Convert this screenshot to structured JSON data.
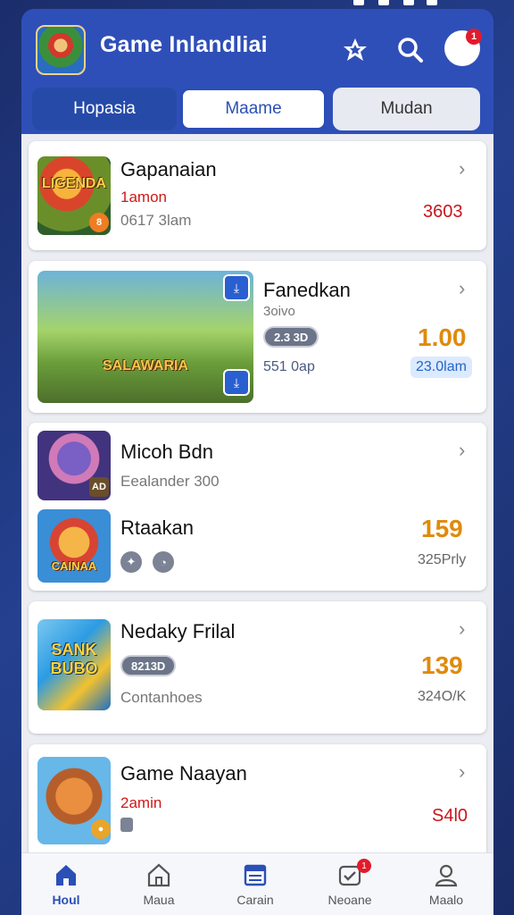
{
  "header": {
    "title": "Game Inlandliai",
    "avatar_badge": "1"
  },
  "tabs": [
    {
      "label": "Hopasia"
    },
    {
      "label": "Maame"
    },
    {
      "label": "Mudan"
    }
  ],
  "cards": [
    {
      "title": "Gapanaian",
      "line1": "1amon",
      "line2": "0617 3lam",
      "value": "3603",
      "thumb_caption": "LIGENDA",
      "thumb_badge": "8"
    },
    {
      "title": "Fanedkan",
      "line1": "3oivo",
      "pill": "2.3 3D",
      "line3": "551 0ap",
      "value": "1.00",
      "tag": "23.0lam",
      "thumb_caption": "SALAWARIA"
    },
    {
      "title": "Micoh Bdn",
      "line1": "Eealander 300",
      "thumb_badge": "AD"
    },
    {
      "title": "Rtaakan",
      "value": "159",
      "sub_value": "325Prly",
      "thumb_caption": "CAINAA"
    },
    {
      "title": "Nedaky Frilal",
      "pill": "8213D",
      "line3": "Contanhoes",
      "value": "139",
      "sub_value": "324O/K",
      "thumb_caption": "SANK BUBO"
    },
    {
      "title": "Game Naayan",
      "line1": "2amin",
      "value": "S4l0"
    }
  ],
  "bottom_nav": [
    {
      "label": "Houl",
      "icon": "home-icon",
      "active": true
    },
    {
      "label": "Maua",
      "icon": "house-outline-icon"
    },
    {
      "label": "Carain",
      "icon": "list-icon"
    },
    {
      "label": "Neoane",
      "icon": "checkbox-icon",
      "badge": "1"
    },
    {
      "label": "Maalo",
      "icon": "profile-icon"
    }
  ],
  "colors": {
    "accent": "#2f4fb8",
    "price_red": "#c8161d",
    "price_orange": "#e08a0b",
    "badge_red": "#e21b2b"
  }
}
